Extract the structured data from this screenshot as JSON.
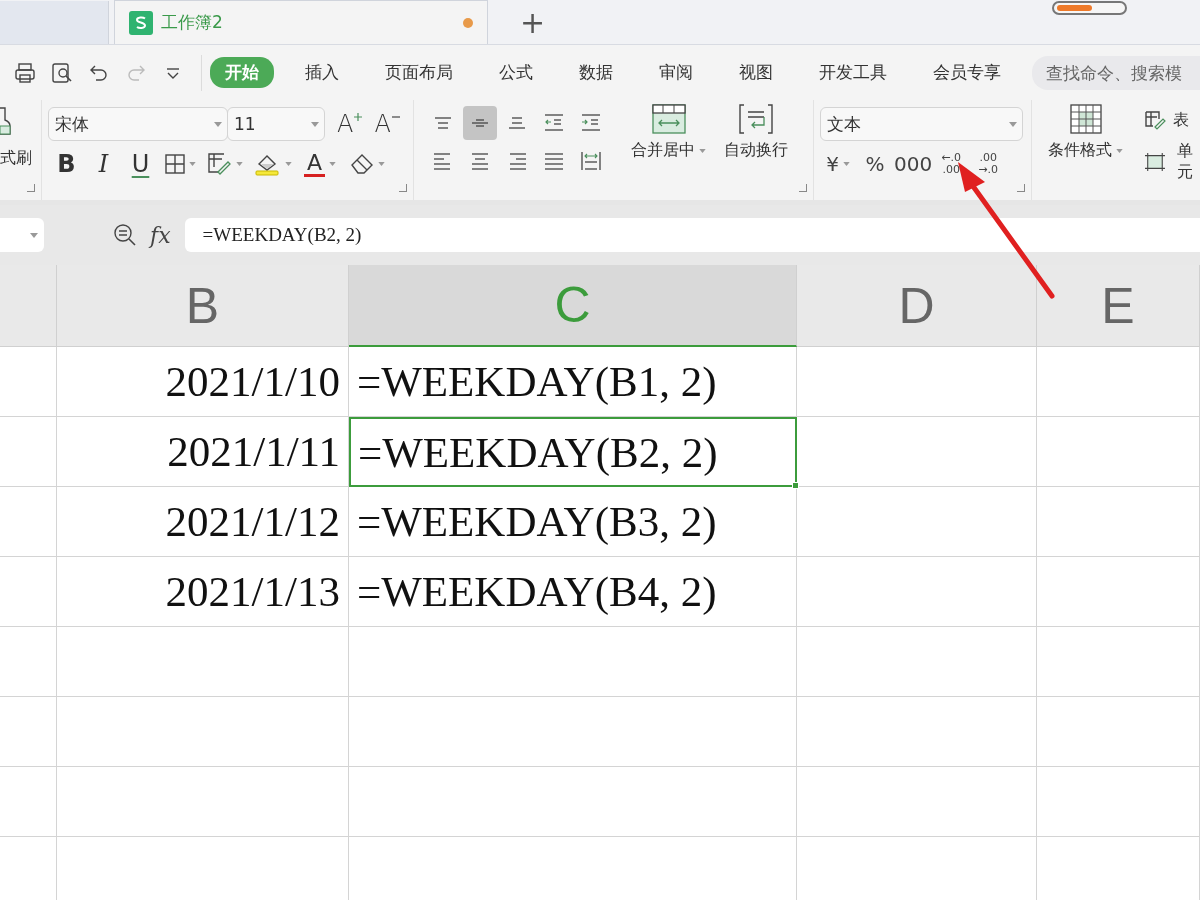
{
  "doc_tabs": [
    {
      "title": "工作簿2",
      "selected": true,
      "modified": true
    }
  ],
  "new_tab": "+",
  "menu_tabs": [
    {
      "label": "开始",
      "selected": true
    },
    {
      "label": "插入",
      "selected": false
    },
    {
      "label": "页面布局",
      "selected": false
    },
    {
      "label": "公式",
      "selected": false
    },
    {
      "label": "数据",
      "selected": false
    },
    {
      "label": "审阅",
      "selected": false
    },
    {
      "label": "视图",
      "selected": false
    },
    {
      "label": "开发工具",
      "selected": false
    },
    {
      "label": "会员专享",
      "selected": false
    }
  ],
  "search": {
    "placeholder": "查找命令、搜索模"
  },
  "ribbon": {
    "painter_label": "式刷",
    "font_name": "宋体",
    "font_size": "11",
    "font_buttons": [
      {
        "kind": "grow",
        "label": "A"
      },
      {
        "kind": "shrink",
        "label": "A"
      }
    ],
    "style_buttons": [
      {
        "kind": "bold",
        "label": "B"
      },
      {
        "kind": "italic",
        "label": "I"
      },
      {
        "kind": "underline",
        "label": "U"
      }
    ],
    "font_color_label": "A",
    "align_buttons": [
      {
        "kind": "top",
        "selected": false
      },
      {
        "kind": "middle",
        "selected": true
      },
      {
        "kind": "bottom",
        "selected": false
      },
      {
        "kind": "outdent",
        "selected": false
      },
      {
        "kind": "indent",
        "selected": false
      },
      {
        "kind": "left",
        "selected": false
      },
      {
        "kind": "center",
        "selected": false
      },
      {
        "kind": "right",
        "selected": false
      },
      {
        "kind": "justify",
        "selected": false
      },
      {
        "kind": "distributed",
        "selected": false
      }
    ],
    "merge_label": "合并居中",
    "wrap_label": "自动换行",
    "number_format": "文本",
    "number_buttons": [
      {
        "kind": "currency",
        "lines": [
          "¥"
        ]
      },
      {
        "kind": "percent",
        "lines": [
          "%"
        ]
      },
      {
        "kind": "thousands",
        "lines": [
          "000"
        ]
      },
      {
        "kind": "decimal",
        "lines": [
          "←.0",
          ".00"
        ]
      },
      {
        "kind": "decimal",
        "lines": [
          ".00",
          "→.0"
        ]
      }
    ],
    "conditional_label": "条件格式",
    "table_style_label": "表",
    "cell_style_label": "单元"
  },
  "formula_bar": {
    "function_label": "fx",
    "formula": "=WEEKDAY(B2, 2)"
  },
  "columns": [
    {
      "selected": false
    },
    {
      "label": "B",
      "selected": false
    },
    {
      "label": "C",
      "selected": true
    },
    {
      "label": "D",
      "selected": false
    },
    {
      "label": "E",
      "selected": false
    }
  ],
  "rows": [
    {
      "date": "2021/1/10",
      "formula": "=WEEKDAY(B1, 2)",
      "selected": false
    },
    {
      "date": "2021/1/11",
      "formula": "=WEEKDAY(B2, 2)",
      "selected": true
    },
    {
      "date": "2021/1/12",
      "formula": "=WEEKDAY(B3, 2)",
      "selected": false
    },
    {
      "date": "2021/1/13",
      "formula": "=WEEKDAY(B4, 2)",
      "selected": false
    },
    {
      "selected": false
    },
    {
      "selected": false
    },
    {
      "selected": false
    },
    {
      "selected": false
    }
  ]
}
